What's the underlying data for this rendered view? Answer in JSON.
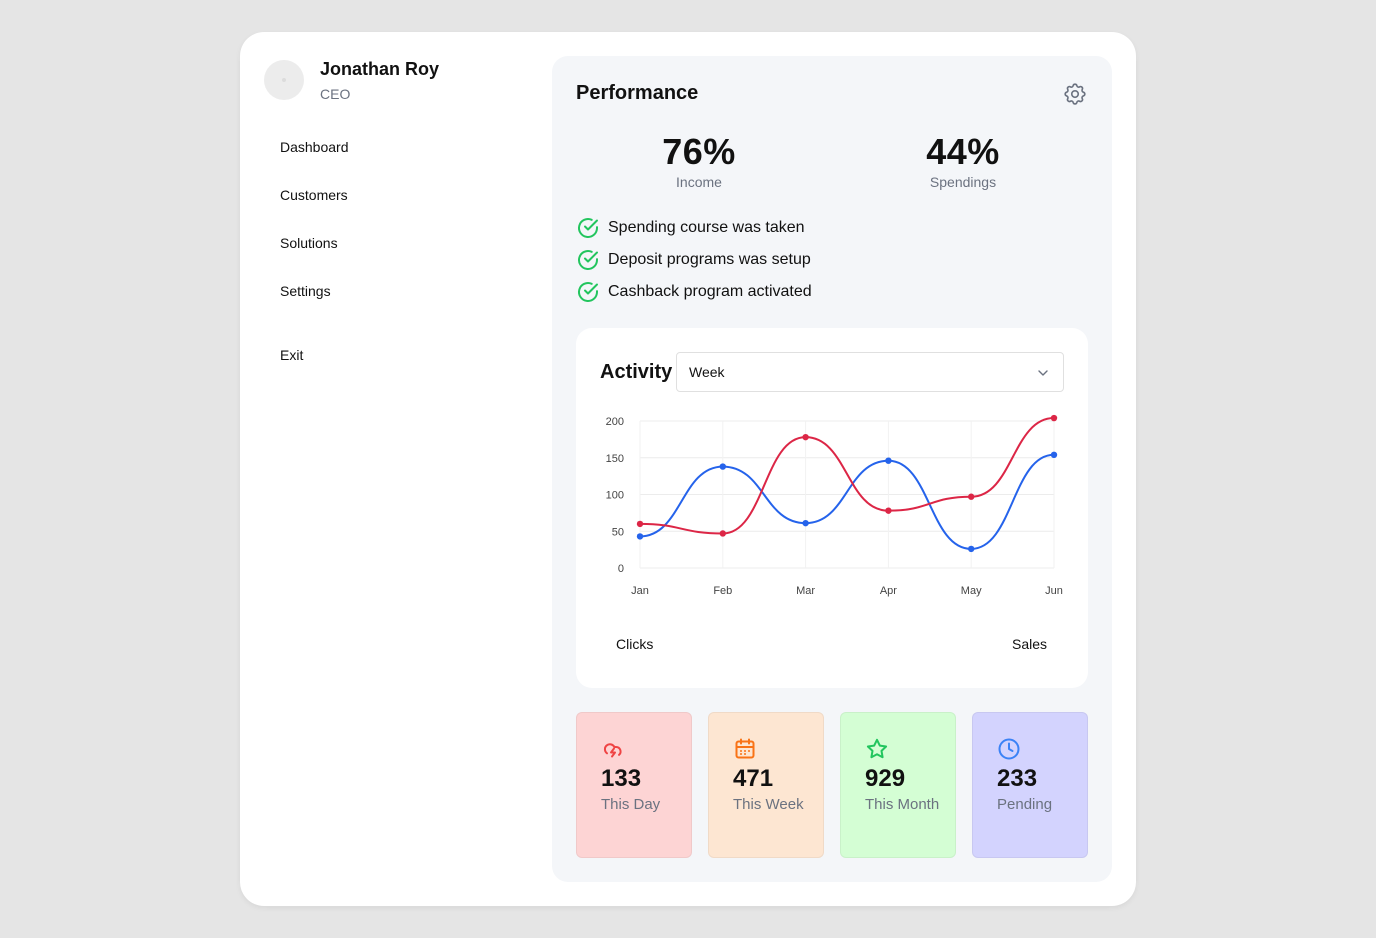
{
  "profile": {
    "name": "Jonathan Roy",
    "role": "CEO"
  },
  "nav": {
    "dashboard": "Dashboard",
    "customers": "Customers",
    "solutions": "Solutions",
    "settings": "Settings",
    "exit": "Exit"
  },
  "performance": {
    "title": "Performance",
    "settings_icon": "gear-icon",
    "stats": [
      {
        "value": "76%",
        "label": "Income"
      },
      {
        "value": "44%",
        "label": "Spendings"
      }
    ],
    "checklist": [
      "Spending course was taken",
      "Deposit programs was setup",
      "Cashback program activated"
    ],
    "check_color": "#22c55e"
  },
  "activity": {
    "title": "Activity",
    "period": "Week",
    "legend": [
      "Clicks",
      "Sales"
    ]
  },
  "chart_data": {
    "type": "line",
    "x": [
      "Jan",
      "Feb",
      "Mar",
      "Apr",
      "May",
      "Jun"
    ],
    "ylim": [
      0,
      200
    ],
    "yticks": [
      0,
      50,
      100,
      150,
      200
    ],
    "grid": true,
    "series": [
      {
        "name": "Clicks",
        "color": "#2563eb",
        "values": [
          43,
          138,
          61,
          146,
          26,
          154
        ]
      },
      {
        "name": "Sales",
        "color": "#dc2646",
        "values": [
          60,
          47,
          178,
          78,
          97,
          204
        ]
      }
    ]
  },
  "tiles": [
    {
      "value": "133",
      "label": "This Day",
      "icon": "cloud-lightning-icon",
      "color": "#ef4444",
      "bg": "#fdd4d4"
    },
    {
      "value": "471",
      "label": "This Week",
      "icon": "calendar-icon",
      "color": "#f97316",
      "bg": "#fde6d2"
    },
    {
      "value": "929",
      "label": "This Month",
      "icon": "star-icon",
      "color": "#22c55e",
      "bg": "#d4fed4"
    },
    {
      "value": "233",
      "label": "Pending",
      "icon": "clock-icon",
      "color": "#3b82f6",
      "bg": "#d3d3fe"
    }
  ]
}
